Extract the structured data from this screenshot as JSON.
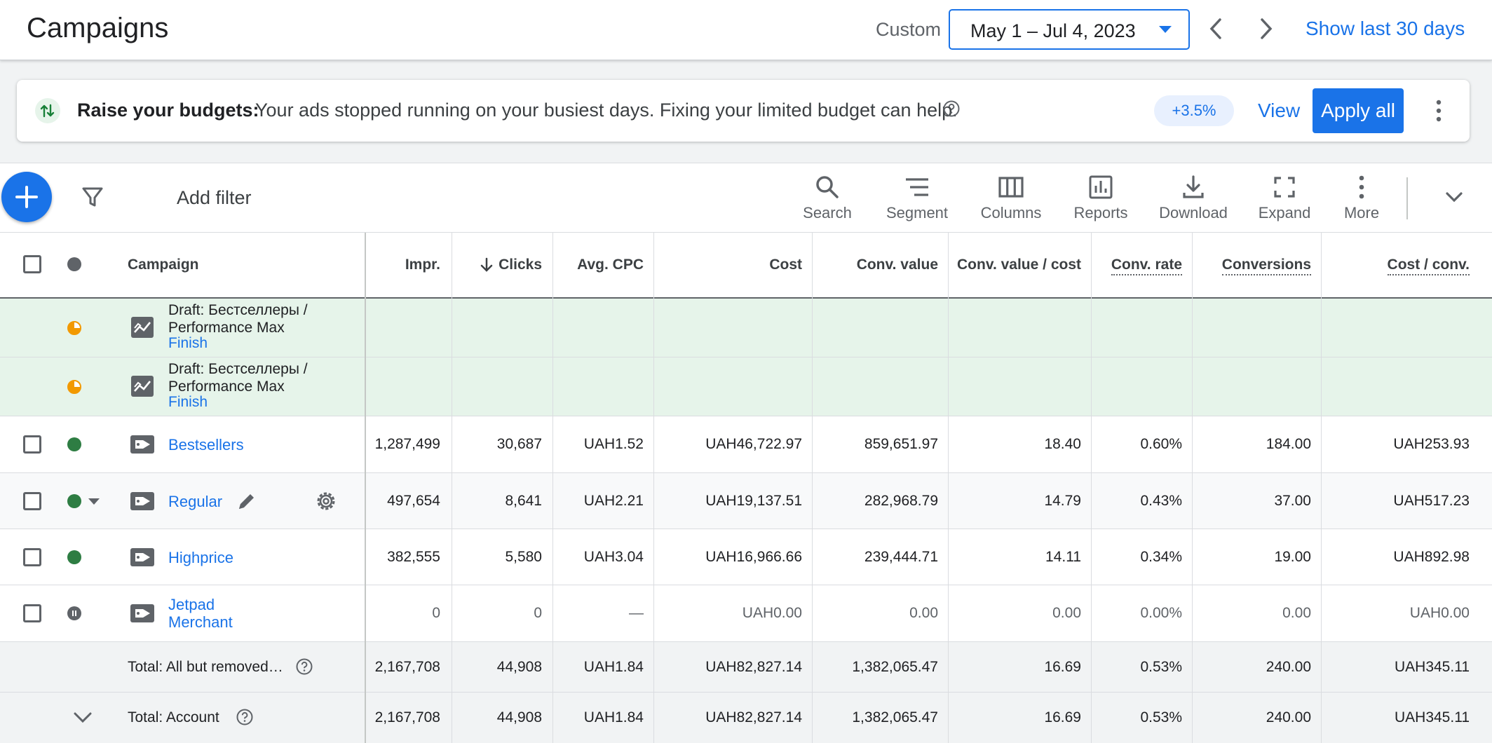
{
  "header": {
    "title": "Campaigns",
    "custom_label": "Custom",
    "date_range": "May 1 – Jul 4, 2023",
    "show_last": "Show last 30 days"
  },
  "banner": {
    "bold": "Raise your budgets:",
    "text": "Your ads stopped running on your busiest days. Fixing your limited budget can help.",
    "pill": "+3.5%",
    "view": "View",
    "apply": "Apply all"
  },
  "toolbar": {
    "add_filter": "Add filter",
    "tools": [
      {
        "label": "Search",
        "icon": "search-icon"
      },
      {
        "label": "Segment",
        "icon": "segment-icon"
      },
      {
        "label": "Columns",
        "icon": "columns-icon"
      },
      {
        "label": "Reports",
        "icon": "reports-icon"
      },
      {
        "label": "Download",
        "icon": "download-icon"
      },
      {
        "label": "Expand",
        "icon": "expand-icon"
      },
      {
        "label": "More",
        "icon": "more-icon"
      }
    ]
  },
  "table": {
    "headers": {
      "campaign": "Campaign",
      "impr": "Impr.",
      "clicks": "Clicks",
      "avg_cpc": "Avg. CPC",
      "cost": "Cost",
      "conv_value": "Conv. value",
      "conv_value_cost": "Conv. value / cost",
      "conv_rate": "Conv. rate",
      "conversions": "Conversions",
      "cost_conv": "Cost / conv."
    },
    "drafts": [
      {
        "name": "Draft: Бестселлеры / Performance Max",
        "action": "Finish"
      },
      {
        "name": "Draft: Бестселлеры / Performance Max",
        "action": "Finish"
      }
    ],
    "rows": [
      {
        "name": "Bestsellers",
        "status": "enabled",
        "impr": "1,287,499",
        "clicks": "30,687",
        "avg_cpc": "UAH1.52",
        "cost": "UAH46,722.97",
        "conv_value": "859,651.97",
        "conv_value_cost": "18.40",
        "conv_rate": "0.60%",
        "conversions": "184.00",
        "cost_conv": "UAH253.93"
      },
      {
        "name": "Regular",
        "status": "enabled",
        "impr": "497,654",
        "clicks": "8,641",
        "avg_cpc": "UAH2.21",
        "cost": "UAH19,137.51",
        "conv_value": "282,968.79",
        "conv_value_cost": "14.79",
        "conv_rate": "0.43%",
        "conversions": "37.00",
        "cost_conv": "UAH517.23"
      },
      {
        "name": "Highprice",
        "status": "enabled",
        "impr": "382,555",
        "clicks": "5,580",
        "avg_cpc": "UAH3.04",
        "cost": "UAH16,966.66",
        "conv_value": "239,444.71",
        "conv_value_cost": "14.11",
        "conv_rate": "0.34%",
        "conversions": "19.00",
        "cost_conv": "UAH892.98"
      },
      {
        "name": "Jetpad Merchant",
        "status": "paused",
        "impr": "0",
        "clicks": "0",
        "avg_cpc": "—",
        "cost": "UAH0.00",
        "conv_value": "0.00",
        "conv_value_cost": "0.00",
        "conv_rate": "0.00%",
        "conversions": "0.00",
        "cost_conv": "UAH0.00"
      }
    ],
    "totals": [
      {
        "label": "Total: All but removed…",
        "impr": "2,167,708",
        "clicks": "44,908",
        "avg_cpc": "UAH1.84",
        "cost": "UAH82,827.14",
        "conv_value": "1,382,065.47",
        "conv_value_cost": "16.69",
        "conv_rate": "0.53%",
        "conversions": "240.00",
        "cost_conv": "UAH345.11"
      },
      {
        "label": "Total: Account",
        "impr": "2,167,708",
        "clicks": "44,908",
        "avg_cpc": "UAH1.84",
        "cost": "UAH82,827.14",
        "conv_value": "1,382,065.47",
        "conv_value_cost": "16.69",
        "conv_rate": "0.53%",
        "conversions": "240.00",
        "cost_conv": "UAH345.11"
      }
    ]
  },
  "colors": {
    "accent": "#1a73e8",
    "enabled": "#2e7d43",
    "draft": "#f29900",
    "draft_bg": "#e6f4ea"
  }
}
